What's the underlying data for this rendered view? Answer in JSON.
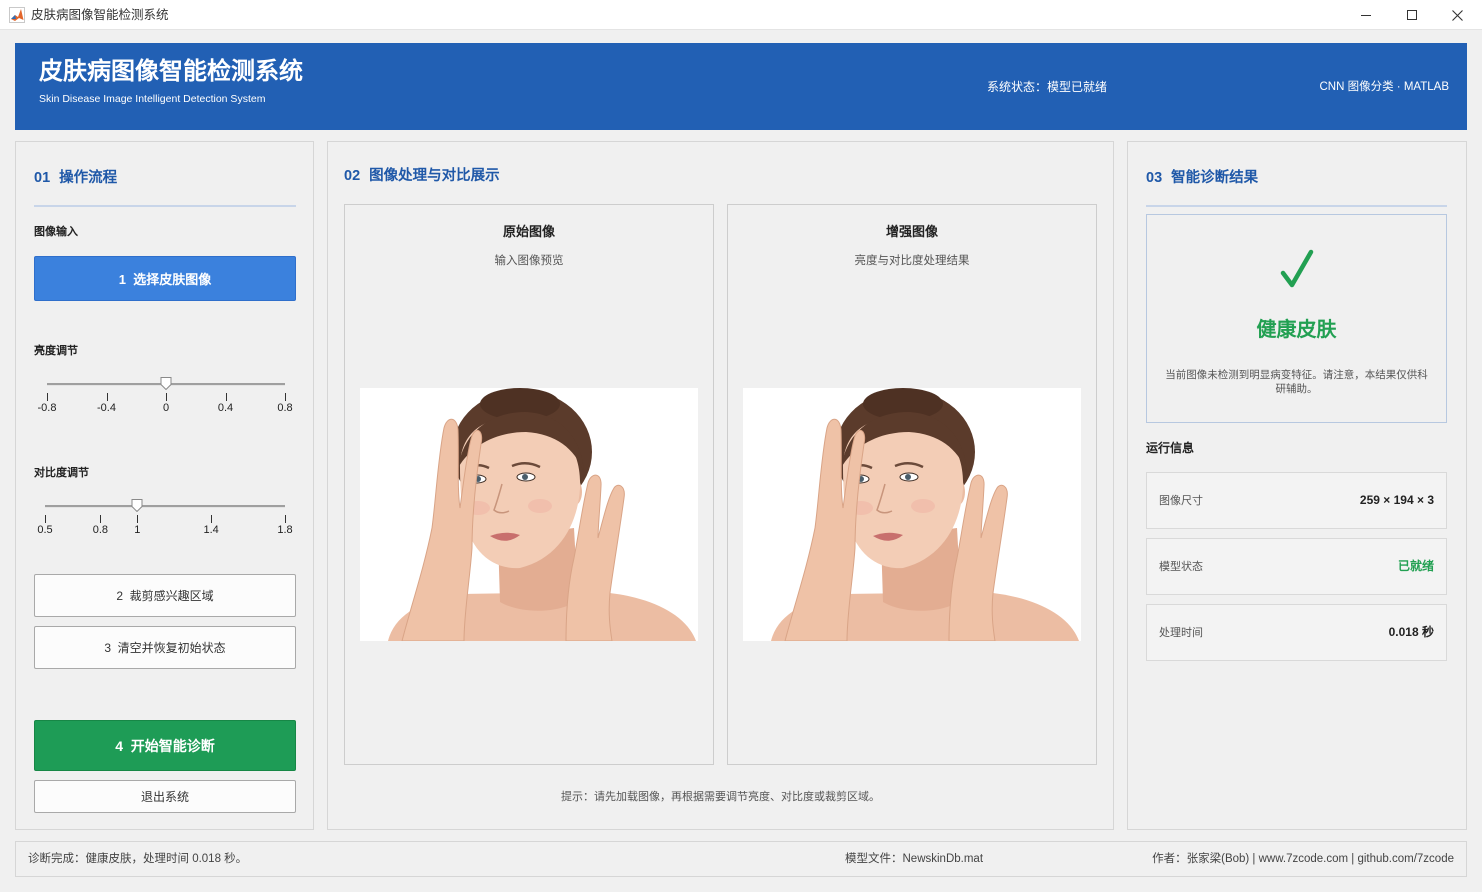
{
  "window": {
    "title": "皮肤病图像智能检测系统"
  },
  "icons": {
    "app": "matlab-icon",
    "minimize": "minimize-icon",
    "maximize": "maximize-icon",
    "close": "close-icon",
    "result": "checkmark-icon"
  },
  "colors": {
    "header_bg": "#2260b4",
    "section_title": "#1f58a8",
    "primary_button": "#3b81dd",
    "diagnose_button": "#1e9c56",
    "healthy": "#22a052",
    "ready_status": "#22a052"
  },
  "header": {
    "title": "皮肤病图像智能检测系统",
    "subtitle": "Skin Disease Image Intelligent Detection System",
    "system_status": "系统状态：模型已就绪",
    "tech": "CNN 图像分类 · MATLAB"
  },
  "left_panel": {
    "num": "01",
    "title": "操作流程",
    "input_label": "图像输入",
    "select_button": "1  选择皮肤图像",
    "brightness": {
      "label": "亮度调节",
      "min": -0.8,
      "max": 0.8,
      "value": 0,
      "ticks": [
        "-0.8",
        "-0.4",
        "0",
        "0.4",
        "0.8"
      ]
    },
    "contrast": {
      "label": "对比度调节",
      "min": 0.5,
      "max": 1.8,
      "value": 1,
      "ticks": [
        "0.5",
        "0.8",
        "1",
        "1.4",
        "1.8"
      ]
    },
    "crop_button": "2  裁剪感兴趣区域",
    "reset_button": "3  清空并恢复初始状态",
    "diagnose_button": "4  开始智能诊断",
    "exit_button": "退出系统"
  },
  "middle_panel": {
    "num": "02",
    "title": "图像处理与对比展示",
    "original": {
      "title": "原始图像",
      "caption": "输入图像预览"
    },
    "enhanced": {
      "title": "增强图像",
      "caption": "亮度与对比度处理结果"
    },
    "hint": "提示：请先加载图像，再根据需要调节亮度、对比度或裁剪区域。"
  },
  "right_panel": {
    "num": "03",
    "title": "智能诊断结果",
    "result": {
      "label": "健康皮肤",
      "description": "当前图像未检测到明显病变特征。请注意，本结果仅供科研辅助。"
    },
    "run_info_title": "运行信息",
    "run_info": [
      {
        "label": "图像尺寸",
        "value": "259 × 194 × 3"
      },
      {
        "label": "模型状态",
        "value": "已就绪"
      },
      {
        "label": "处理时间",
        "value": "0.018 秒"
      }
    ]
  },
  "status_bar": {
    "message": "诊断完成：健康皮肤，处理时间 0.018 秒。",
    "model_file": "模型文件：NewskinDb.mat",
    "author": "作者：张家梁(Bob) | www.7zcode.com | github.com/7zcode"
  }
}
